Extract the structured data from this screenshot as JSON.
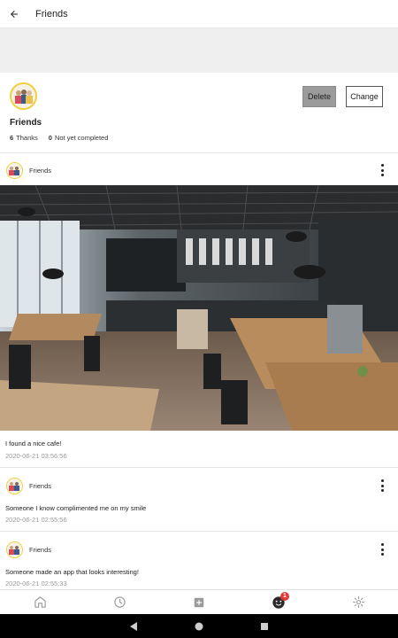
{
  "appbar": {
    "title": "Friends",
    "back_icon": "arrow-back-icon"
  },
  "profile": {
    "name": "Friends",
    "delete_label": "Delete",
    "change_label": "Change",
    "stats": [
      {
        "count": "6",
        "label": "Thanks"
      },
      {
        "count": "0",
        "label": "Not yet completed"
      }
    ]
  },
  "posts": [
    {
      "author": "Friends",
      "text": "I found a nice cafe!",
      "time": "2020-06-21 03:56:56",
      "has_photo": true
    },
    {
      "author": "Friends",
      "text": "Someone I know complimented me on my smile",
      "time": "2020-06-21 02:55:56"
    },
    {
      "author": "Friends",
      "text": "Someone made an app that looks interesting!",
      "time": "2020-06-21 02:55:33"
    }
  ],
  "nav": {
    "items": [
      "home-icon",
      "history-icon",
      "add-box-icon",
      "notification-face-icon",
      "settings-icon"
    ],
    "badge_count": "1"
  },
  "colors": {
    "accent_badge": "#e53935",
    "avatar_ring": "#f2cf3a",
    "delete_bg": "#9b9b9b"
  }
}
